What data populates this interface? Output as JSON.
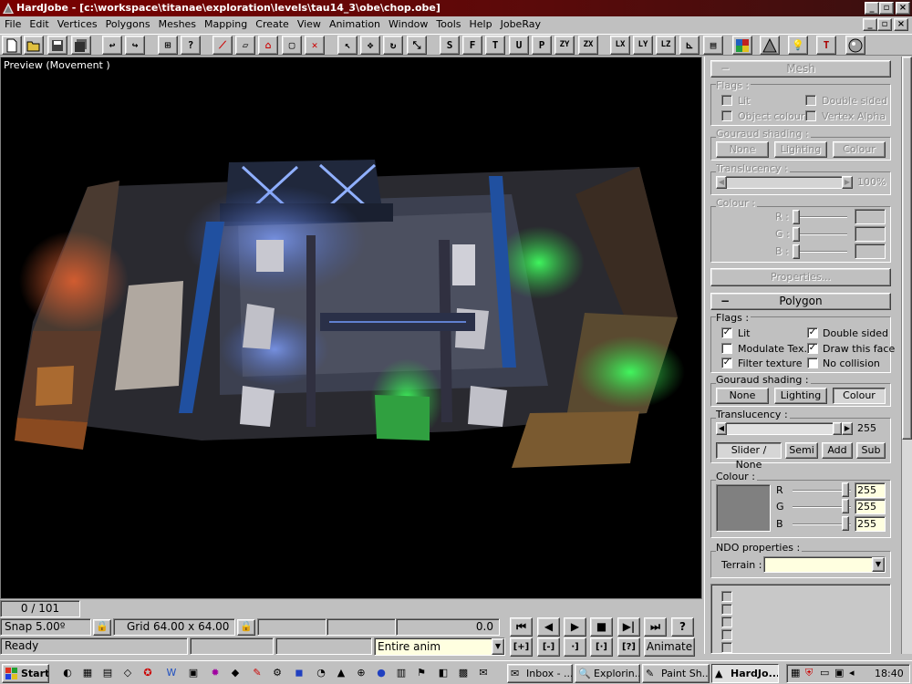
{
  "window": {
    "title": "HardJobe - [c:\\workspace\\titanae\\exploration\\levels\\tau14_3\\obe\\chop.obe]",
    "controls": [
      "_",
      "▫",
      "×"
    ]
  },
  "menu": [
    "File",
    "Edit",
    "Vertices",
    "Polygons",
    "Meshes",
    "Mapping",
    "Create",
    "View",
    "Animation",
    "Window",
    "Tools",
    "Help",
    "JobeRay"
  ],
  "toolbar": {
    "view_buttons": [
      "S",
      "F",
      "T",
      "U",
      "P",
      "ZY",
      "ZX",
      "LX",
      "LY",
      "LZ"
    ]
  },
  "viewport": {
    "caption": "Preview (Movement )"
  },
  "mesh_panel": {
    "header": "Mesh",
    "flags_label": "Flags :",
    "flags": [
      {
        "label": "Lit",
        "checked": false
      },
      {
        "label": "Double sided",
        "checked": false
      },
      {
        "label": "Object colour",
        "checked": false
      },
      {
        "label": "Vertex Alpha",
        "checked": false
      }
    ],
    "gouraud_label": "Gouraud shading :",
    "gouraud_buttons": [
      "None",
      "Lighting",
      "Colour"
    ],
    "translucency_label": "Translucency :",
    "translucency_value": "100%",
    "colour_label": "Colour :",
    "channels": [
      "R :",
      "G :",
      "B :"
    ],
    "properties_button": "Properties..."
  },
  "polygon_panel": {
    "header": "Polygon",
    "flags_label": "Flags :",
    "flags": [
      {
        "label": "Lit",
        "checked": true
      },
      {
        "label": "Double sided",
        "checked": true
      },
      {
        "label": "Modulate Tex.",
        "checked": false
      },
      {
        "label": "Draw this face",
        "checked": true
      },
      {
        "label": "Filter texture",
        "checked": true
      },
      {
        "label": "No collision",
        "checked": false
      }
    ],
    "gouraud_label": "Gouraud shading :",
    "gouraud_buttons": [
      "None",
      "Lighting",
      "Colour"
    ],
    "gouraud_selected": "Colour",
    "translucency_label": "Translucency :",
    "translucency_value": "255",
    "blend_buttons": [
      "Slider / None",
      "Semi",
      "Add",
      "Sub"
    ],
    "colour_label": "Colour :",
    "channels": [
      {
        "label": "R",
        "value": "255"
      },
      {
        "label": "G",
        "value": "255"
      },
      {
        "label": "B",
        "value": "255"
      }
    ],
    "swatch_color": "#808080",
    "ndo_label": "NDO properties :",
    "terrain_label": "Terrain :",
    "terrain_value": ""
  },
  "status": {
    "frame_counter": "0 / 101",
    "snap": "Snap 5.00º",
    "grid": "Grid 64.00 x 64.00",
    "time": "0.0",
    "ready": "Ready",
    "anim_range": "Entire anim",
    "animate_button": "Animate",
    "transport": [
      "⏮",
      "◀",
      "▶",
      "■",
      "▶|",
      "⏭",
      "?"
    ],
    "transport2": [
      "[+]",
      "[-]",
      "·]",
      "[·]",
      "[?]"
    ]
  },
  "taskbar": {
    "start": "Start",
    "tasks": [
      "Inbox - ...",
      "Explorin...",
      "Paint Sh...",
      "HardJo..."
    ],
    "active_task": "HardJo...",
    "clock": "18:40"
  },
  "colors": {
    "title_bar": "#7a0000",
    "face": "#c0c0c0",
    "input_yellow": "#ffffe0"
  }
}
